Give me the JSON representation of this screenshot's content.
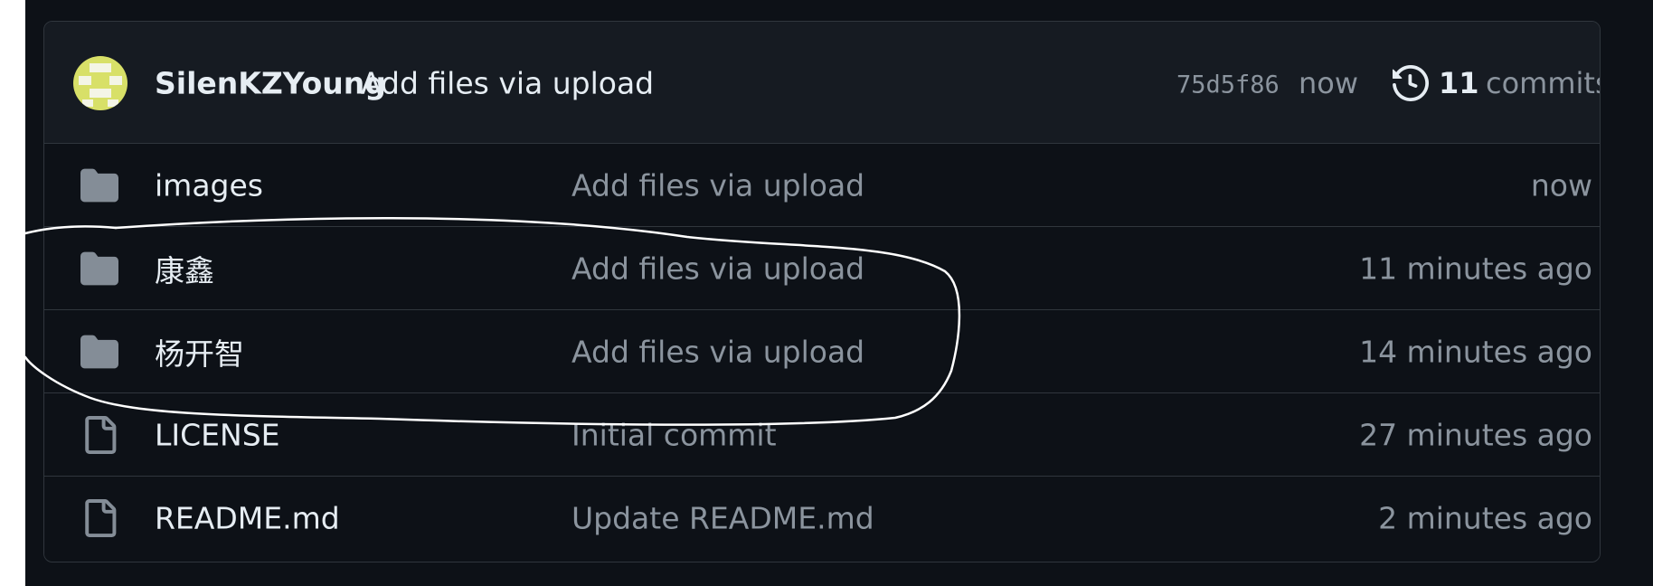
{
  "latest_commit": {
    "author": "SilenKZYoung",
    "message": "Add files via upload",
    "sha": "75d5f86",
    "time": "now",
    "commit_count": "11",
    "commits_label": "commits"
  },
  "files": [
    {
      "type": "folder",
      "icon": "folder-icon",
      "name": "images",
      "message": "Add files via upload",
      "time": "now"
    },
    {
      "type": "folder",
      "icon": "folder-icon",
      "name": "康鑫",
      "message": "Add files via upload",
      "time": "11 minutes ago"
    },
    {
      "type": "folder",
      "icon": "folder-icon",
      "name": "杨开智",
      "message": "Add files via upload",
      "time": "14 minutes ago"
    },
    {
      "type": "file",
      "icon": "file-icon",
      "name": "LICENSE",
      "message": "Initial commit",
      "time": "27 minutes ago"
    },
    {
      "type": "file",
      "icon": "file-icon",
      "name": "README.md",
      "message": "Update README.md",
      "time": "2 minutes ago"
    }
  ],
  "colors": {
    "background": "#0d1117",
    "header_background": "#161b22",
    "border": "#30363d",
    "text_primary": "#e6edf3",
    "text_muted": "#8b949e",
    "icon": "#848d97",
    "annotation_stroke": "#ffffff"
  }
}
